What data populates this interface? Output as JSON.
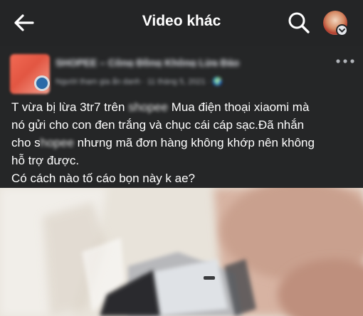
{
  "header": {
    "title": "Video khác",
    "icons": [
      "back-arrow-icon",
      "search-icon"
    ]
  },
  "post": {
    "page_name": "SHOPEE – Cộng Đồng Không Lừa Đảo",
    "meta": "Người tham gia ẩn danh · 11 tháng 5, 2021 · 🌍",
    "line1_pre": "T vừa bị lừa 3tr7 trên ",
    "line1_blur": "shopee",
    "line1_post": " Mua điện thoại xiaomi mà",
    "line2": "nó gửi cho con đen trắng và chục cái cáp sạc.Đã nhắn",
    "line3_pre": "cho s",
    "line3_blur": "hopee",
    "line3_post": " nhưng mã đơn hàng không khớp nên không",
    "line4": "hỗ trợ được.",
    "line5": "Có cách nào tố cáo bọn này k ae?"
  },
  "colors": {
    "topbar": "#242526",
    "card": "#252627",
    "text": "#ffffff",
    "secondary_text": "#b0b3b8"
  }
}
